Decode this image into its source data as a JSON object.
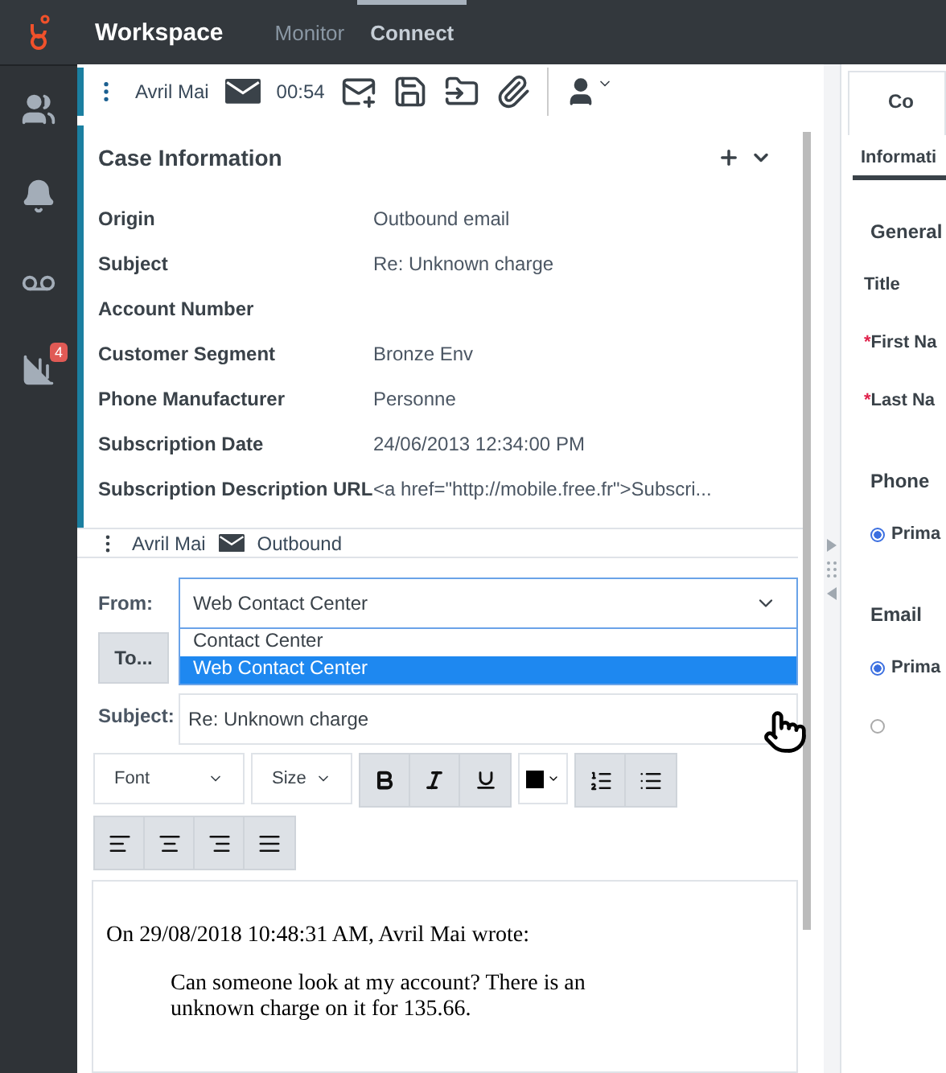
{
  "top_bar": {
    "title": "Workspace",
    "nav": [
      {
        "label": "Monitor",
        "selected": false
      },
      {
        "label": "Connect",
        "selected": true
      }
    ]
  },
  "sidebar": {
    "items": [
      {
        "kind": "contacts"
      },
      {
        "kind": "alerts"
      },
      {
        "kind": "voicemail"
      },
      {
        "kind": "reports",
        "badge": "4"
      }
    ]
  },
  "toolbar": {
    "contact": "Avril Mai",
    "timer": "00:54"
  },
  "case_information": {
    "title": "Case Information",
    "fields": [
      {
        "label": "Origin",
        "value": "Outbound email"
      },
      {
        "label": "Subject",
        "value": "Re: Unknown charge"
      },
      {
        "label": "Account Number"
      },
      {
        "label": "Customer Segment",
        "value": "Bronze Env"
      },
      {
        "label": "Phone Manufacturer",
        "value": "Personne"
      },
      {
        "label": "Subscription Date",
        "value": "24/06/2013 12:34:00 PM"
      },
      {
        "label": "Subscription Description URL",
        "value": "<a href=\"http://mobile.free.fr\">Subscri..."
      }
    ]
  },
  "interaction_bar": {
    "contact": "Avril Mai",
    "direction": "Outbound"
  },
  "email": {
    "from_label": "From:",
    "from_value": "Web Contact Center",
    "from_options": [
      {
        "label": "Contact Center",
        "selected": false
      },
      {
        "label": "Web Contact Center",
        "selected": true
      }
    ],
    "to_button": "To...",
    "subject_label": "Subject:",
    "subject_value": "Re: Unknown charge",
    "font": "Font",
    "size": "Size",
    "body": {
      "header": "On 29/08/2018 10:48:31 AM, Avril Mai wrote:",
      "quote": "Can someone look at my account? There is an unknown charge on it for 135.66."
    }
  },
  "right_panel": {
    "tab": "Co",
    "subtabs": [
      {
        "label": "Informati",
        "selected": true
      }
    ],
    "items": [
      {
        "kind": "heading",
        "text": "General"
      },
      {
        "kind": "field",
        "text": "Title"
      },
      {
        "kind": "field",
        "text": "First Na",
        "required_mark": "*"
      },
      {
        "kind": "field",
        "text": "Last Na",
        "required_mark": "*"
      },
      {
        "kind": "heading",
        "text": "Phone"
      },
      {
        "kind": "radio",
        "text": "Prima",
        "selected": true
      },
      {
        "kind": "heading",
        "text": "Email"
      },
      {
        "kind": "radio",
        "text": "Prima",
        "selected": true
      },
      {
        "kind": "radio",
        "selected": false
      }
    ]
  }
}
